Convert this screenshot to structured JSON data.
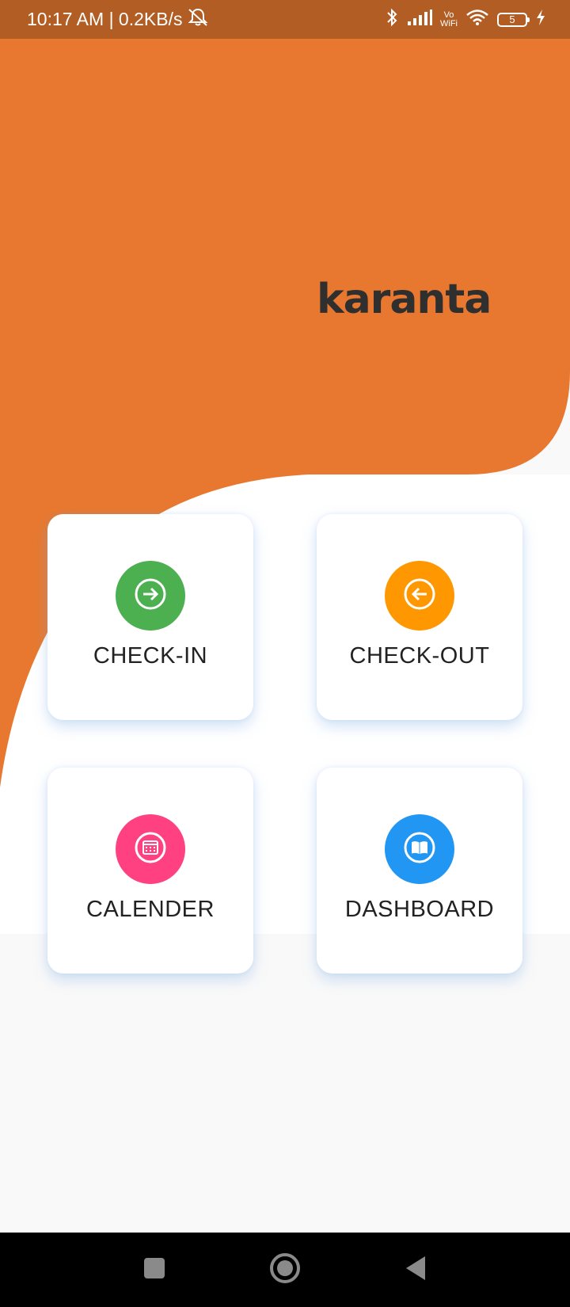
{
  "status_bar": {
    "time_speed": "10:17 AM | 0.2KB/s",
    "vowifi_top": "Vo",
    "vowifi_bottom": "WiFi",
    "battery_level": "5",
    "icons": [
      "alarm-off-icon",
      "bluetooth-icon",
      "signal-icon",
      "vowifi-icon",
      "wifi-icon",
      "battery-icon",
      "charging-icon"
    ]
  },
  "brand": {
    "logo_text": "karanta",
    "primary_color": "#e8782f"
  },
  "menu": {
    "items": [
      {
        "label": "CHECK-IN",
        "icon": "arrow-right-circle-icon",
        "color": "#4caf50"
      },
      {
        "label": "CHECK-OUT",
        "icon": "arrow-left-circle-icon",
        "color": "#ff9800"
      },
      {
        "label": "CALENDER",
        "icon": "calendar-icon",
        "color": "#ff4081"
      },
      {
        "label": "DASHBOARD",
        "icon": "book-icon",
        "color": "#2196f3"
      }
    ]
  },
  "nav_bar": {
    "icons": [
      "recent-apps-icon",
      "home-icon",
      "back-icon"
    ]
  }
}
